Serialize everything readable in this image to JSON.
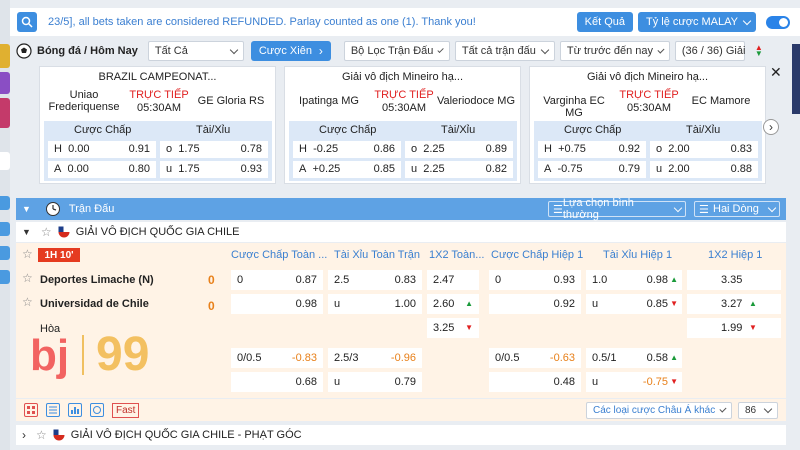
{
  "notice": {
    "text": "23/5], all bets taken are considered REFUNDED. Parlay counted as one (1). Thank you!",
    "results_label": "Kết Quả",
    "odds_type_label": "Tỷ lệ cược MALAY"
  },
  "filters": {
    "sport_label": "Bóng đá / Hôm Nay",
    "all_label": "Tất Cả",
    "parlay_label": "Cược Xiên",
    "match_filter_label": "Bộ Lọc Trận Đấu",
    "all_matches_label": "Tất cả trận đấu",
    "sort_label": "Từ trước đến nay",
    "count_label": "(36 / 36) Giải"
  },
  "cards": [
    {
      "league": "BRAZIL CAMPEONAT...",
      "home": "Uniao Frederiquense",
      "away": "GE Gloria RS",
      "live": "TRỰC TIẾP",
      "time": "05:30AM",
      "hdp_label": "Cược Chấp",
      "ou_label": "Tài/Xỉu",
      "rows": [
        {
          "side": "H",
          "hdp": "0.00",
          "hdp_odds": "0.91",
          "ou_side": "o",
          "ou": "1.75",
          "ou_odds": "0.78"
        },
        {
          "side": "A",
          "hdp": "0.00",
          "hdp_odds": "0.80",
          "ou_side": "u",
          "ou": "1.75",
          "ou_odds": "0.93"
        }
      ]
    },
    {
      "league": "Giải vô địch Mineiro hạ...",
      "home": "Ipatinga MG",
      "away": "Valeriodoce MG",
      "live": "TRỰC TIẾP",
      "time": "05:30AM",
      "hdp_label": "Cược Chấp",
      "ou_label": "Tài/Xỉu",
      "rows": [
        {
          "side": "H",
          "hdp": "-0.25",
          "hdp_odds": "0.86",
          "ou_side": "o",
          "ou": "2.25",
          "ou_odds": "0.89"
        },
        {
          "side": "A",
          "hdp": "+0.25",
          "hdp_odds": "0.85",
          "ou_side": "u",
          "ou": "2.25",
          "ou_odds": "0.82"
        }
      ]
    },
    {
      "league": "Giải vô địch Mineiro hạ...",
      "home": "Varginha EC MG",
      "away": "EC Mamore",
      "live": "TRỰC TIẾP",
      "time": "05:30AM",
      "hdp_label": "Cược Chấp",
      "ou_label": "Tài/Xỉu",
      "rows": [
        {
          "side": "H",
          "hdp": "+0.75",
          "hdp_odds": "0.92",
          "ou_side": "o",
          "ou": "2.00",
          "ou_odds": "0.83"
        },
        {
          "side": "A",
          "hdp": "-0.75",
          "hdp_odds": "0.79",
          "ou_side": "u",
          "ou": "2.00",
          "ou_odds": "0.88"
        }
      ]
    }
  ],
  "main": {
    "header_label": "Trận Đấu",
    "view_label": "Lựa chọn bình thường",
    "lines_label": "Hai Dòng",
    "league": "GIẢI VÔ ĐỊCH QUỐC GIA CHILE",
    "league2": "GIẢI VÔ ĐỊCH QUỐC GIA CHILE - PHẠT GÓC",
    "columns": [
      "Cược Chấp Toàn ...",
      "Tài Xỉu Toàn Trận",
      "1X2 Toàn...",
      "Cược Chấp Hiệp 1",
      "Tài Xỉu Hiệp 1",
      "1X2 Hiệp 1"
    ],
    "live_badge": "1H 10'",
    "home_team": "Deportes Limache (N)",
    "away_team": "Universidad de Chile",
    "home_score": "0",
    "away_score": "0",
    "draw_label": "Hòa",
    "watermark_left": "bj",
    "watermark_right": "99",
    "row1": {
      "hdp_line": "0",
      "hdp_home": "0.87",
      "hdp_away": "0.98",
      "ou_line": "2.5",
      "ou_over": "0.83",
      "ou_u": "u",
      "ou_under": "1.00",
      "x12_home": "2.47",
      "x12_away": "2.60",
      "x12_draw": "3.25",
      "h1_hdp_line": "0",
      "h1_hdp_home": "0.93",
      "h1_hdp_away": "0.92",
      "h1_ou_line": "1.0",
      "h1_ou_over": "0.98",
      "h1_ou_u": "u",
      "h1_ou_under": "0.85",
      "h1_x12_home": "3.35",
      "h1_x12_away": "3.27",
      "h1_x12_draw": "1.99"
    },
    "row2": {
      "hdp_line": "0/0.5",
      "hdp_home": "-0.83",
      "hdp_away": "0.68",
      "ou_line": "2.5/3",
      "ou_over": "-0.96",
      "ou_u": "u",
      "ou_under": "0.79",
      "h1_hdp_line": "0/0.5",
      "h1_hdp_home": "-0.63",
      "h1_hdp_away": "0.48",
      "h1_ou_line": "0.5/1",
      "h1_ou_over": "0.58",
      "h1_ou_u": "u",
      "h1_ou_under": "-0.75"
    },
    "fast_label": "Fast",
    "bet_types_label": "Các loại cược Châu Á khác",
    "more_count": "86"
  },
  "colors": {
    "accent": "#3d8ee0",
    "header": "#5ea2e4",
    "live": "#e02020",
    "score": "#e8801a"
  }
}
